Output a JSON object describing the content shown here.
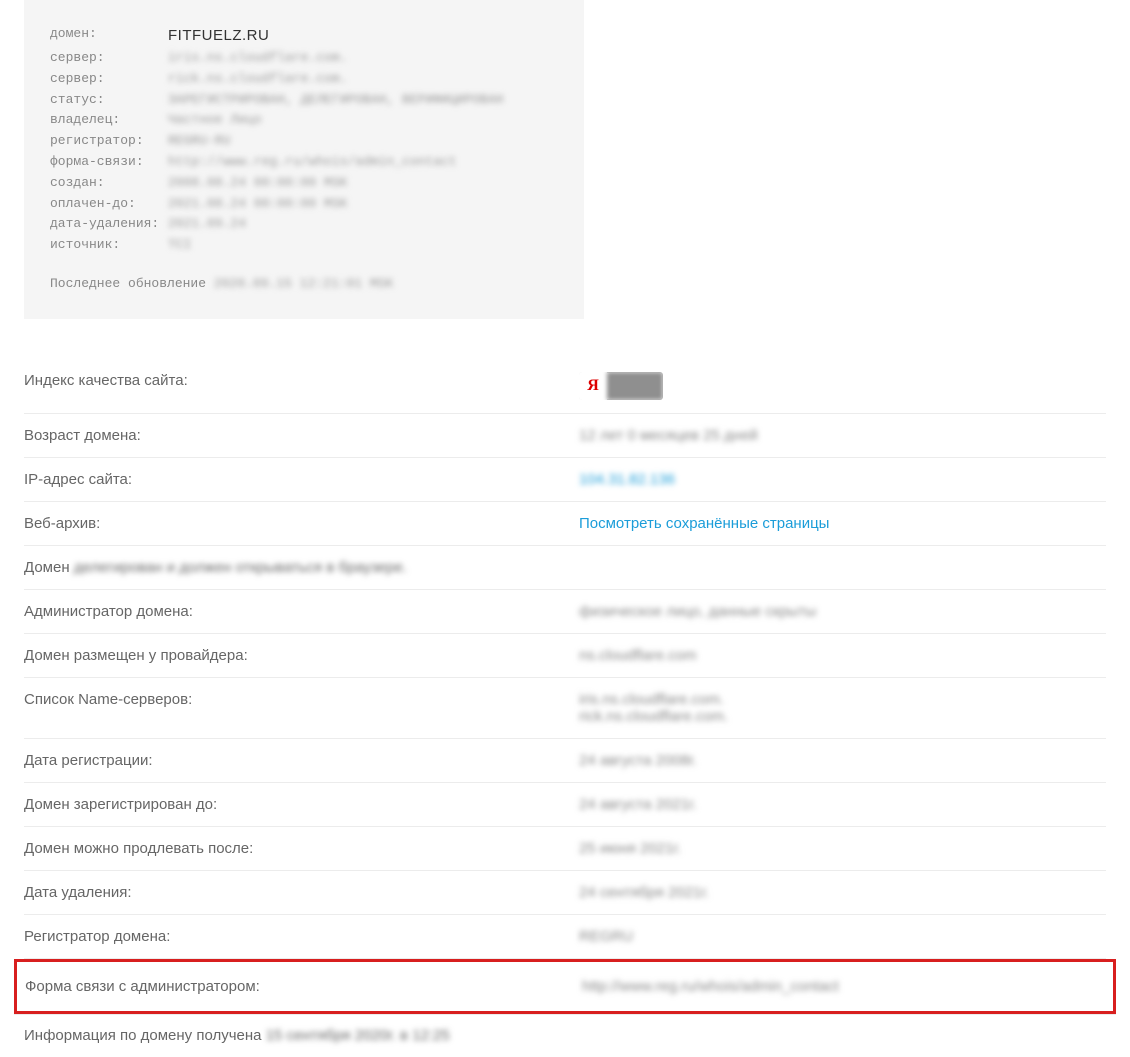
{
  "whois": {
    "rows": [
      {
        "k": "домен:",
        "v": "FITFUELZ.RU",
        "clear": true
      },
      {
        "k": "сервер:",
        "v": "iris.ns.cloudflare.com."
      },
      {
        "k": "сервер:",
        "v": "rick.ns.cloudflare.com."
      },
      {
        "k": "статус:",
        "v": "ЗАРЕГИСТРИРОВАН, ДЕЛЕГИРОВАН, ВЕРИФИЦИРОВАН"
      },
      {
        "k": "владелец:",
        "v": "Частное Лицо"
      },
      {
        "k": "регистратор:",
        "v": "REGRU-RU"
      },
      {
        "k": "форма-связи:",
        "v": "http://www.reg.ru/whois/admin_contact"
      },
      {
        "k": "создан:",
        "v": "2008.08.24 00:00:00 MSK"
      },
      {
        "k": "оплачен-до:",
        "v": "2021.08.24 00:00:00 MSK"
      },
      {
        "k": "дата-удаления:",
        "v": "2021.09.24"
      },
      {
        "k": "источник:",
        "v": "TCI"
      }
    ],
    "footer_prefix": "Последнее обновление ",
    "footer_date": "2020.09.15 12:21:01 MSK"
  },
  "yandex_label": "Я",
  "rows": [
    {
      "label": "Индекс качества сайта:",
      "type": "badge"
    },
    {
      "label": "Возраст домена:",
      "value": "12 лет 0 месяцев 25 дней",
      "blur": true
    },
    {
      "label": "IP-адрес сайта:",
      "value": "104.31.82.136",
      "link": true,
      "blur": true
    },
    {
      "label": "Веб-архив:",
      "value": "Посмотреть сохранённые страницы",
      "link": true
    },
    {
      "label": "Домен ",
      "inline_value": "делегирован и должен открываться в браузере.",
      "inline": true
    },
    {
      "label": "Администратор домена:",
      "value": "физическое лицо, данные скрыты",
      "blur": true
    },
    {
      "label": "Домен размещен у провайдера:",
      "value": "ns.cloudflare.com",
      "blur": true
    },
    {
      "label": "Список Name-серверов:",
      "value": "iris.ns.cloudflare.com.",
      "value2": "rick.ns.cloudflare.com.",
      "blur": true
    },
    {
      "label": "Дата регистрации:",
      "value": "24 августа 2008г.",
      "blur": true
    },
    {
      "label": "Домен зарегистрирован до:",
      "value": "24 августа 2021г.",
      "blur": true
    },
    {
      "label": "Домен можно продлевать после:",
      "value": "25 июня 2021г.",
      "blur": true
    },
    {
      "label": "Дата удаления:",
      "value": "24 сентября 2021г.",
      "blur": true
    },
    {
      "label": "Регистратор домена:",
      "value": "REGRU",
      "blur": true
    },
    {
      "label": "Форма связи с администратором:",
      "value": "http://www.reg.ru/whois/admin_contact",
      "blur": true,
      "highlight": true
    },
    {
      "label": "Информация по домену получена ",
      "inline_value": "15 сентября 2020г. в 12:25",
      "inline": true,
      "footer": true
    }
  ]
}
